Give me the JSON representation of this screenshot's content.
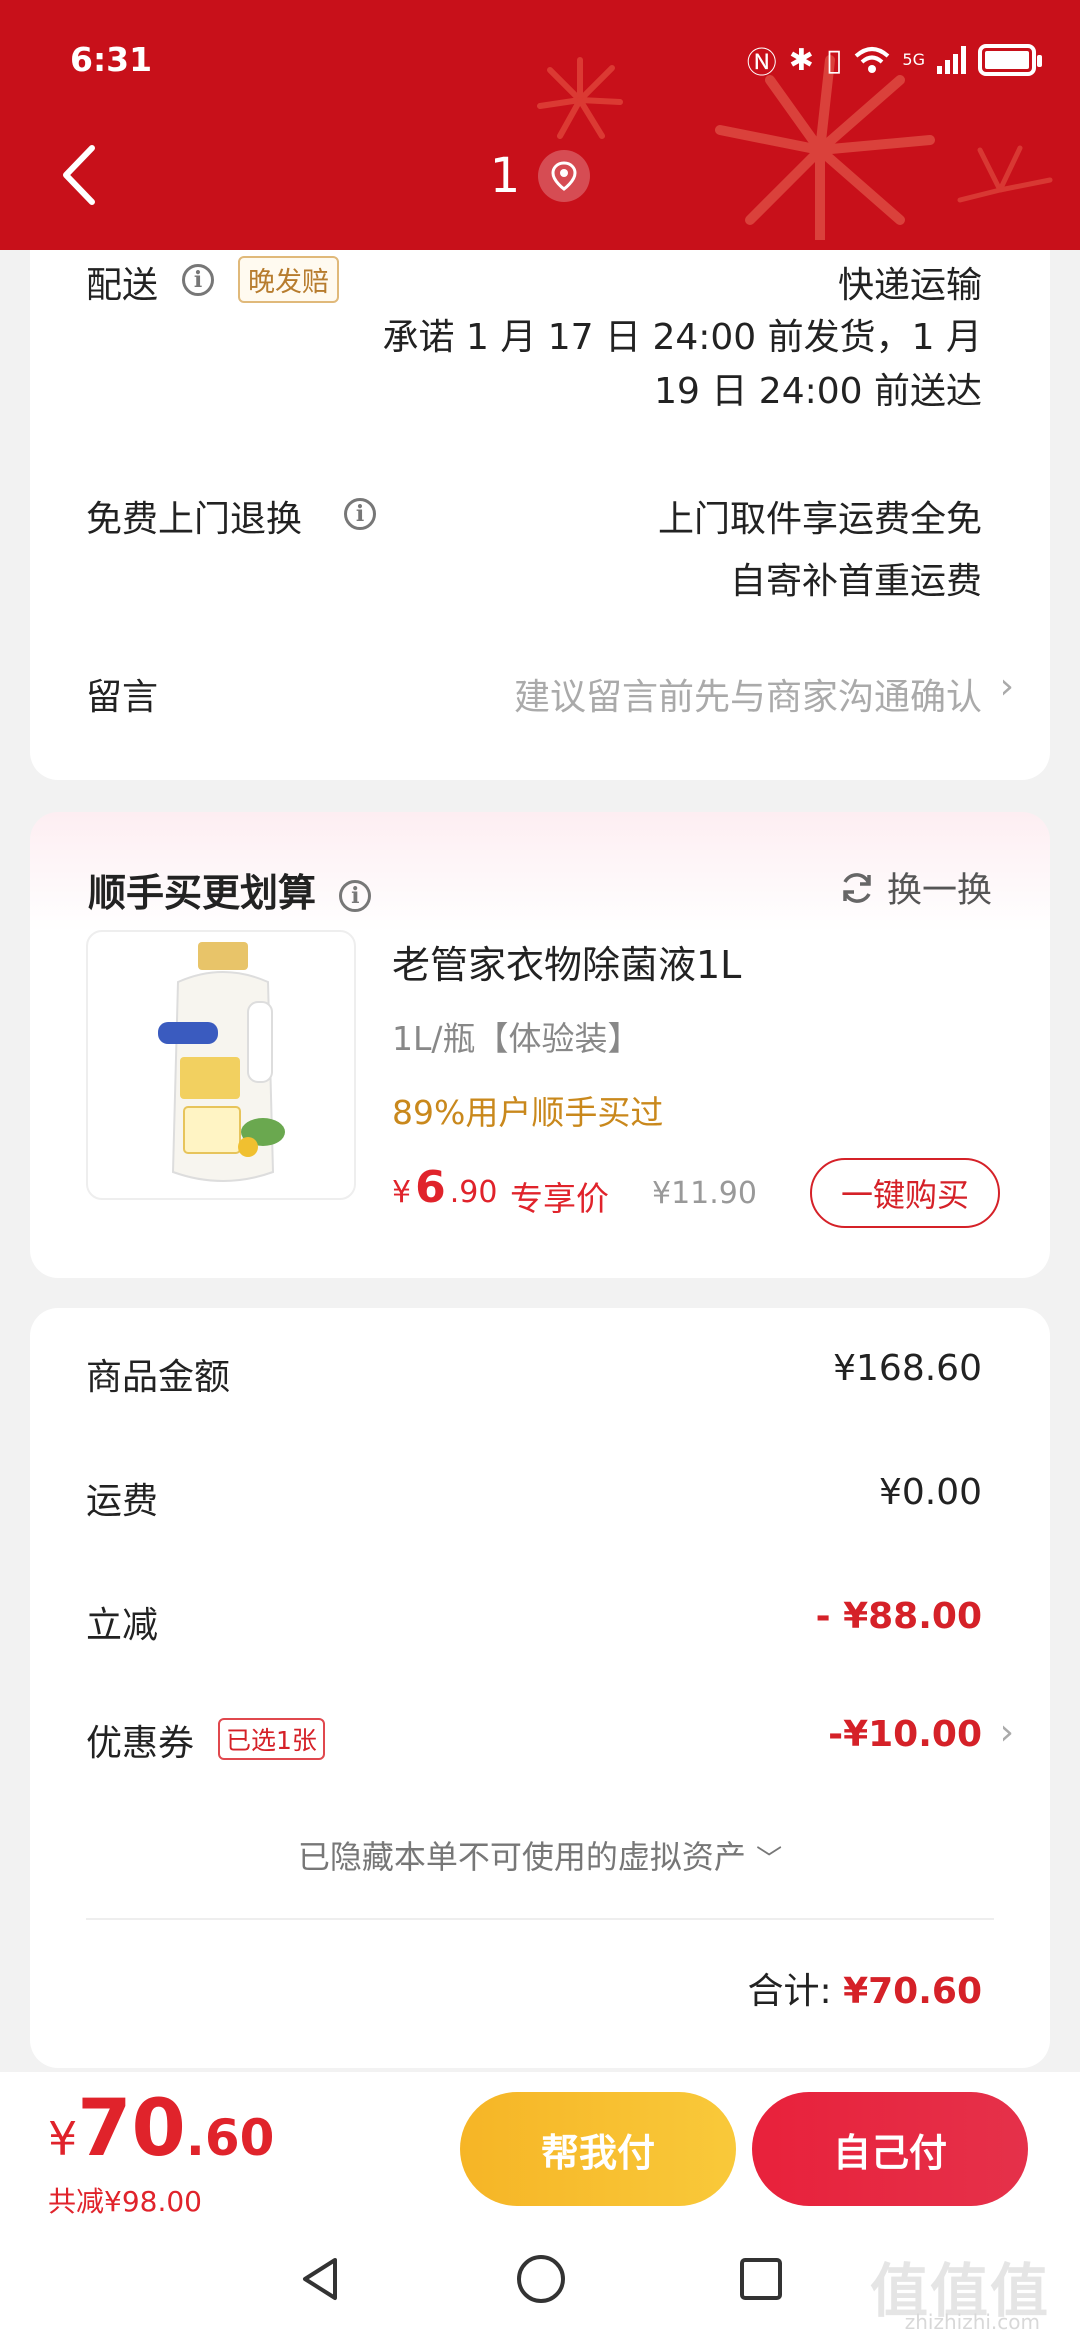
{
  "status_bar": {
    "time": "6:31",
    "network": "5G"
  },
  "header": {
    "title": "1"
  },
  "delivery": {
    "label": "配送",
    "tag": "晚发赔",
    "method": "快递运输",
    "promise_line1": "承诺 1 月 17 日 24:00 前发货，1 月",
    "promise_line2": "19 日 24:00 前送达"
  },
  "returns": {
    "label": "免费上门退换",
    "line1": "上门取件享运费全免",
    "line2": "自寄补首重运费"
  },
  "message": {
    "label": "留言",
    "placeholder": "建议留言前先与商家沟通确认"
  },
  "addon": {
    "title": "顺手买更划算",
    "swap_label": "换一换",
    "product": {
      "name": "老管家衣物除菌液1L",
      "spec": "1L/瓶【体验装】",
      "popularity": "89%用户顺手买过",
      "price_currency": "¥",
      "price_int": "6",
      "price_dec": ".90",
      "exclusive_label": "专享价",
      "original_price": "¥11.90",
      "buy_label": "一键购买"
    }
  },
  "summary": {
    "goods_label": "商品金额",
    "goods_value": "¥168.60",
    "shipping_label": "运费",
    "shipping_value": "¥0.00",
    "discount_label": "立减",
    "discount_value": "- ¥88.00",
    "coupon_label": "优惠券",
    "coupon_tag": "已选1张",
    "coupon_value": "-¥10.00",
    "hidden_assets": "已隐藏本单不可使用的虚拟资产",
    "total_label": "合计:",
    "total_value": "¥70.60"
  },
  "bottom": {
    "currency": "¥",
    "price_int": "70",
    "price_dec": ".60",
    "saved": "共减¥98.00",
    "help_pay": "帮我付",
    "self_pay": "自己付"
  },
  "watermark": {
    "main": "值值值",
    "sub": "zhizhizhi.com"
  },
  "colors": {
    "brand_red": "#c8101a",
    "price_red": "#e0232b",
    "gold": "#c9881c",
    "help_yellow": "#f6b526"
  }
}
